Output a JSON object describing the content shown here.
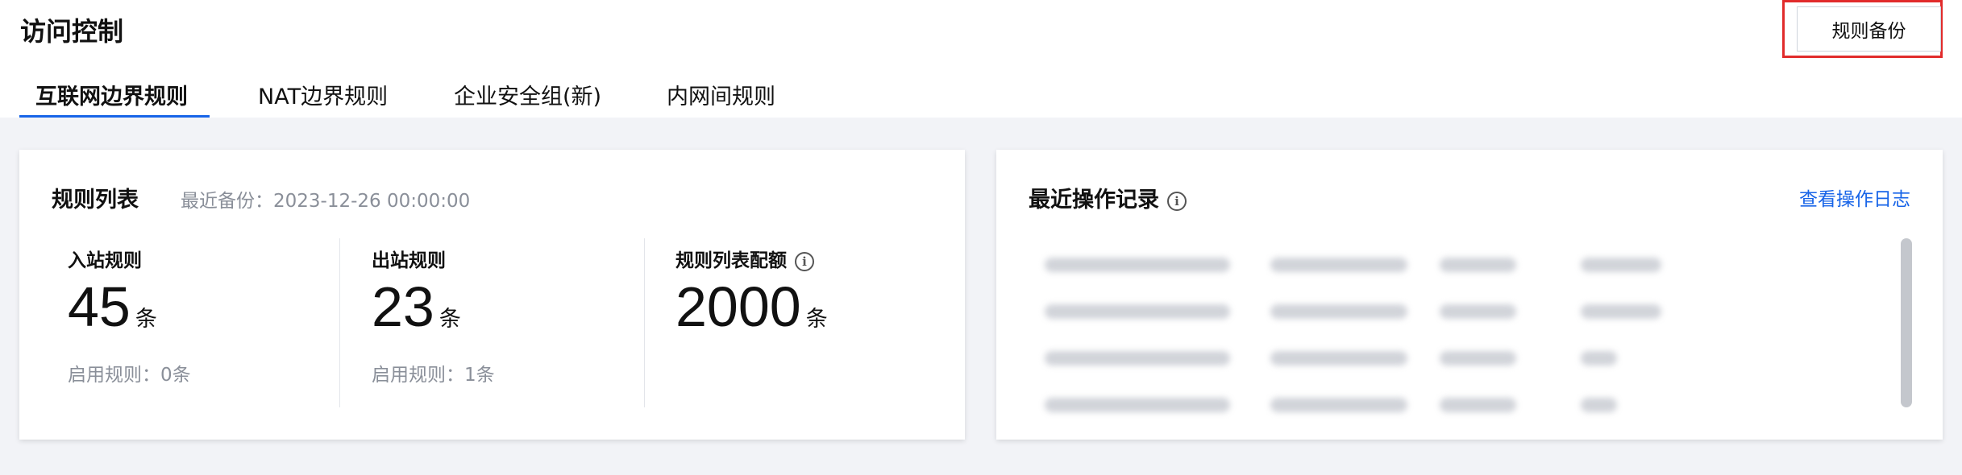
{
  "page": {
    "title": "访问控制"
  },
  "header": {
    "backup_button": "规则备份"
  },
  "tabs": [
    {
      "label": "互联网边界规则",
      "active": true
    },
    {
      "label": "NAT边界规则",
      "active": false
    },
    {
      "label": "企业安全组(新)",
      "active": false
    },
    {
      "label": "内网间规则",
      "active": false
    }
  ],
  "rule_list": {
    "title": "规则列表",
    "last_backup": "最近备份：2023-12-26 00:00:00",
    "stats": [
      {
        "label": "入站规则",
        "value": "45",
        "unit": "条",
        "sub": "启用规则：0条"
      },
      {
        "label": "出站规则",
        "value": "23",
        "unit": "条",
        "sub": "启用规则：1条"
      },
      {
        "label": "规则列表配额",
        "value": "2000",
        "unit": "条",
        "sub": ""
      }
    ]
  },
  "recent_ops": {
    "title": "最近操作记录",
    "link": "查看操作日志"
  },
  "colors": {
    "accent": "#1764e8",
    "highlight": "#e12b2b",
    "background": "#f2f3f7"
  }
}
